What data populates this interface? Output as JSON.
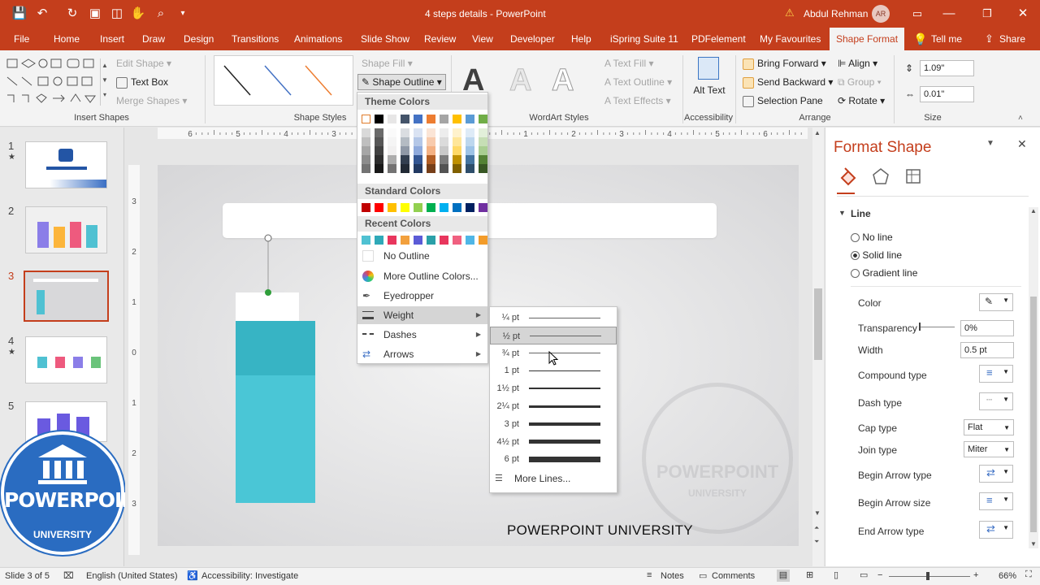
{
  "titlebar": {
    "doc_title": "4 steps details  -  PowerPoint",
    "user_name": "Abdul Rehman",
    "avatar_initials": "AR"
  },
  "tabs": [
    "File",
    "Home",
    "Insert",
    "Draw",
    "Design",
    "Transitions",
    "Animations",
    "Slide Show",
    "Review",
    "View",
    "Developer",
    "Help",
    "iSpring Suite 11",
    "PDFelement",
    "My Favourites",
    "Shape Format",
    "Tell me",
    "Share"
  ],
  "ribbon": {
    "insert_shapes": {
      "edit_shape": "Edit Shape",
      "text_box": "Text Box",
      "merge_shapes": "Merge Shapes",
      "label": "Insert Shapes"
    },
    "shape_styles": {
      "shape_fill": "Shape Fill",
      "shape_outline": "Shape Outline",
      "label": "Shape Styles"
    },
    "wordart": {
      "text_fill": "Text Fill",
      "text_outline": "Text Outline",
      "text_effects": "Text Effects",
      "label": "WordArt Styles",
      "sample": "A"
    },
    "accessibility": {
      "alt_text": "Alt Text",
      "label": "Accessibility"
    },
    "arrange": {
      "bring_forward": "Bring Forward",
      "send_backward": "Send Backward",
      "selection_pane": "Selection Pane",
      "align": "Align",
      "group": "Group",
      "rotate": "Rotate",
      "label": "Arrange"
    },
    "size": {
      "height": "1.09\"",
      "width": "0.01\"",
      "label": "Size"
    }
  },
  "outline_menu": {
    "theme_colors_header": "Theme Colors",
    "standard_colors_header": "Standard Colors",
    "recent_colors_header": "Recent Colors",
    "theme_top": [
      "#ffffff",
      "#000000",
      "#e7e6e6",
      "#44546a",
      "#4472c4",
      "#ed7d31",
      "#a5a5a5",
      "#ffc000",
      "#5b9bd5",
      "#70ad47"
    ],
    "standard": [
      "#c00000",
      "#ff0000",
      "#ffc000",
      "#ffff00",
      "#92d050",
      "#00b050",
      "#00b0f0",
      "#0070c0",
      "#002060",
      "#7030a0"
    ],
    "recent": [
      "#4fc1d2",
      "#2fa9b8",
      "#e8365d",
      "#f2a03d",
      "#5b5bd6",
      "#2aa0a8",
      "#e8365d",
      "#f06080",
      "#4fb6e6",
      "#f39c2a"
    ],
    "no_outline": "No Outline",
    "more_colors": "More Outline Colors...",
    "eyedropper": "Eyedropper",
    "weight": "Weight",
    "dashes": "Dashes",
    "arrows": "Arrows"
  },
  "weight_menu": {
    "items": [
      {
        "label": "¼ pt",
        "pt": 0.25
      },
      {
        "label": "½ pt",
        "pt": 0.5
      },
      {
        "label": "¾ pt",
        "pt": 0.75
      },
      {
        "label": "1 pt",
        "pt": 1
      },
      {
        "label": "1½ pt",
        "pt": 1.5
      },
      {
        "label": "2¼ pt",
        "pt": 2.25
      },
      {
        "label": "3 pt",
        "pt": 3
      },
      {
        "label": "4½ pt",
        "pt": 4.5
      },
      {
        "label": "6 pt",
        "pt": 6
      }
    ],
    "selected": "½ pt",
    "more_lines": "More Lines..."
  },
  "slides": {
    "numbers": [
      "1",
      "2",
      "3",
      "4",
      "5"
    ],
    "current": "3"
  },
  "ruler": {
    "labels": [
      "6",
      "5",
      "4",
      "3",
      "2",
      "1",
      "0",
      "1",
      "2",
      "3",
      "4",
      "5",
      "6"
    ],
    "v_labels": [
      "3",
      "2",
      "1",
      "0",
      "1",
      "2",
      "3"
    ]
  },
  "slide": {
    "footer_text": "POWERPOINT UNIVERSITY",
    "watermark_top": "POWERPOINT",
    "watermark_bottom": "UNIVERSITY"
  },
  "logo": {
    "top": "POWERPOINT",
    "bottom": "UNIVERSITY"
  },
  "format_pane": {
    "title": "Format Shape",
    "section": "Line",
    "options": [
      "No line",
      "Solid line",
      "Gradient line"
    ],
    "selected_option": "Solid line",
    "color_label": "Color",
    "transparency_label": "Transparency",
    "transparency_value": "0%",
    "width_label": "Width",
    "width_value": "0.5 pt",
    "compound_label": "Compound type",
    "dash_label": "Dash type",
    "cap_label": "Cap type",
    "cap_value": "Flat",
    "join_label": "Join type",
    "join_value": "Miter",
    "begin_arrow_type": "Begin Arrow type",
    "begin_arrow_size": "Begin Arrow size",
    "end_arrow_type": "End Arrow type"
  },
  "statusbar": {
    "slide_info": "Slide 3 of 5",
    "language": "English (United States)",
    "accessibility": "Accessibility: Investigate",
    "notes": "Notes",
    "comments": "Comments",
    "zoom": "66%"
  }
}
